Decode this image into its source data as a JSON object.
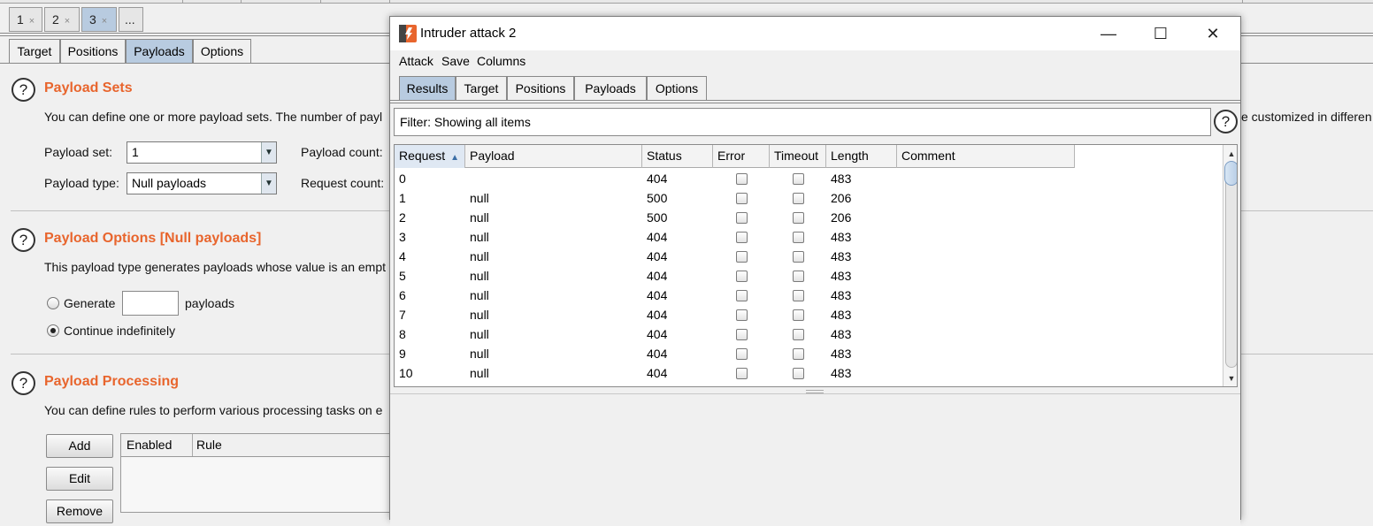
{
  "colors": {
    "section_title": "#e8652d",
    "active_tab": "#b8cbe0"
  },
  "attack_tabs": [
    {
      "label": "1",
      "close": "×"
    },
    {
      "label": "2",
      "close": "×"
    },
    {
      "label": "3",
      "close": "×"
    },
    {
      "label": "..."
    }
  ],
  "config_tabs": [
    "Target",
    "Positions",
    "Payloads",
    "Options"
  ],
  "payload_sets": {
    "title": "Payload Sets",
    "description": "You can define one or more payload sets. The number of payl",
    "description_right": "e customized in differen",
    "payload_set_label": "Payload set:",
    "payload_set_value": "1",
    "payload_type_label": "Payload type:",
    "payload_type_value": "Null payloads",
    "payload_count_label": "Payload count:",
    "request_count_label": "Request count:"
  },
  "payload_options": {
    "title": "Payload Options [Null payloads]",
    "description": "This payload type generates payloads whose value is an empt",
    "generate_label": "Generate",
    "payloads_label": "payloads",
    "generate_value": "",
    "continue_label": "Continue indefinitely",
    "selected_option": "Continue indefinitely"
  },
  "payload_processing": {
    "title": "Payload Processing",
    "description": "You can define rules to perform various processing tasks on e",
    "buttons": {
      "add": "Add",
      "edit": "Edit",
      "remove": "Remove"
    },
    "columns": [
      "Enabled",
      "Rule"
    ]
  },
  "attack_window": {
    "title": "Intruder attack 2",
    "controls": {
      "minimize": "—",
      "maximize": "☐",
      "close": "✕"
    },
    "menu": [
      "Attack",
      "Save",
      "Columns"
    ],
    "tabs": [
      "Results",
      "Target",
      "Positions",
      "Payloads",
      "Options"
    ],
    "active_tab": "Results",
    "filter": "Filter: Showing all items",
    "help": "?",
    "columns": [
      "Request",
      "Payload",
      "Status",
      "Error",
      "Timeout",
      "Length",
      "Comment"
    ],
    "sort_icon": "▲",
    "rows": [
      {
        "request": "0",
        "payload": "",
        "status": "404",
        "error": false,
        "timeout": false,
        "length": "483",
        "comment": ""
      },
      {
        "request": "1",
        "payload": "null",
        "status": "500",
        "error": false,
        "timeout": false,
        "length": "206",
        "comment": ""
      },
      {
        "request": "2",
        "payload": "null",
        "status": "500",
        "error": false,
        "timeout": false,
        "length": "206",
        "comment": ""
      },
      {
        "request": "3",
        "payload": "null",
        "status": "404",
        "error": false,
        "timeout": false,
        "length": "483",
        "comment": ""
      },
      {
        "request": "4",
        "payload": "null",
        "status": "404",
        "error": false,
        "timeout": false,
        "length": "483",
        "comment": ""
      },
      {
        "request": "5",
        "payload": "null",
        "status": "404",
        "error": false,
        "timeout": false,
        "length": "483",
        "comment": ""
      },
      {
        "request": "6",
        "payload": "null",
        "status": "404",
        "error": false,
        "timeout": false,
        "length": "483",
        "comment": ""
      },
      {
        "request": "7",
        "payload": "null",
        "status": "404",
        "error": false,
        "timeout": false,
        "length": "483",
        "comment": ""
      },
      {
        "request": "8",
        "payload": "null",
        "status": "404",
        "error": false,
        "timeout": false,
        "length": "483",
        "comment": ""
      },
      {
        "request": "9",
        "payload": "null",
        "status": "404",
        "error": false,
        "timeout": false,
        "length": "483",
        "comment": ""
      },
      {
        "request": "10",
        "payload": "null",
        "status": "404",
        "error": false,
        "timeout": false,
        "length": "483",
        "comment": ""
      }
    ]
  }
}
